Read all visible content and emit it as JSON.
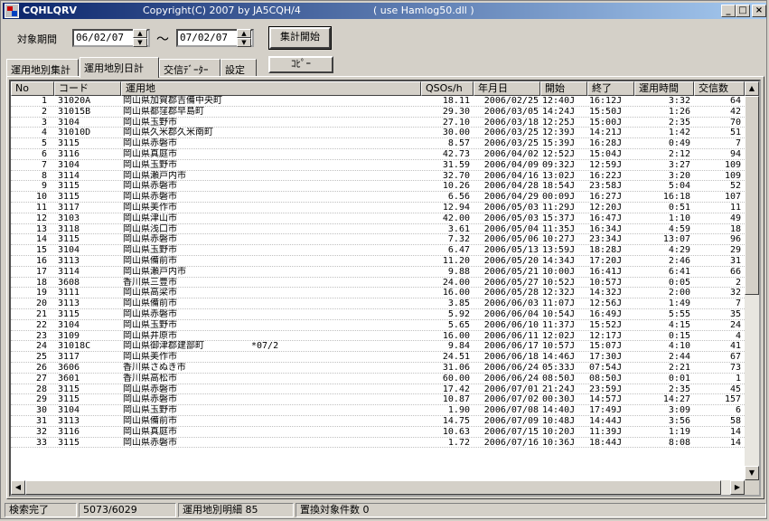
{
  "window": {
    "title": "CQHLQRV",
    "copyright": "Copyright(C) 2007  by  JA5CQH/4",
    "use_hint": "( use Hamlog50.dll )",
    "minimize": "_",
    "maximize": "□",
    "close": "×"
  },
  "toolbar": {
    "period_label": "対象期間",
    "date_from": "06/02/07",
    "tilde": "～",
    "date_to": "07/02/07",
    "aggregate_button": "集計開始",
    "copy_button": "ｺﾋﾟｰ"
  },
  "tabs": [
    {
      "label": "運用地別集計"
    },
    {
      "label": "運用地別日計"
    },
    {
      "label": "交信ﾃﾞｰﾀｰ"
    },
    {
      "label": "設定"
    }
  ],
  "active_tab": "運用地別日計",
  "columns": [
    "No",
    "コード",
    "運用地",
    "QSOs/h",
    "年月日",
    "開始",
    "終了",
    "運用時間",
    "交信数"
  ],
  "rows": [
    [
      "1",
      "31020A",
      "岡山県加賀郡吉備中央町",
      "",
      "18.11",
      "2006/02/25",
      "12:40J",
      "16:12J",
      "3:32",
      "64"
    ],
    [
      "2",
      "31015B",
      "岡山県都窪郡早島町",
      "",
      "29.30",
      "2006/03/05",
      "14:24J",
      "15:50J",
      "1:26",
      "42"
    ],
    [
      "3",
      "3104",
      "岡山県玉野市",
      "",
      "27.10",
      "2006/03/18",
      "12:25J",
      "15:00J",
      "2:35",
      "70"
    ],
    [
      "4",
      "31010D",
      "岡山県久米郡久米南町",
      "",
      "30.00",
      "2006/03/25",
      "12:39J",
      "14:21J",
      "1:42",
      "51"
    ],
    [
      "5",
      "3115",
      "岡山県赤磐市",
      "",
      "8.57",
      "2006/03/25",
      "15:39J",
      "16:28J",
      "0:49",
      "7"
    ],
    [
      "6",
      "3116",
      "岡山県真庭市",
      "",
      "42.73",
      "2006/04/02",
      "12:52J",
      "15:04J",
      "2:12",
      "94"
    ],
    [
      "7",
      "3104",
      "岡山県玉野市",
      "",
      "31.59",
      "2006/04/09",
      "09:32J",
      "12:59J",
      "3:27",
      "109"
    ],
    [
      "8",
      "3114",
      "岡山県瀬戸内市",
      "",
      "32.70",
      "2006/04/16",
      "13:02J",
      "16:22J",
      "3:20",
      "109"
    ],
    [
      "9",
      "3115",
      "岡山県赤磐市",
      "",
      "10.26",
      "2006/04/28",
      "18:54J",
      "23:58J",
      "5:04",
      "52"
    ],
    [
      "10",
      "3115",
      "岡山県赤磐市",
      "",
      "6.56",
      "2006/04/29",
      "00:09J",
      "16:27J",
      "16:18",
      "107"
    ],
    [
      "11",
      "3117",
      "岡山県美作市",
      "",
      "12.94",
      "2006/05/03",
      "11:29J",
      "12:20J",
      "0:51",
      "11"
    ],
    [
      "12",
      "3103",
      "岡山県津山市",
      "",
      "42.00",
      "2006/05/03",
      "15:37J",
      "16:47J",
      "1:10",
      "49"
    ],
    [
      "13",
      "3118",
      "岡山県浅口市",
      "",
      "3.61",
      "2006/05/04",
      "11:35J",
      "16:34J",
      "4:59",
      "18"
    ],
    [
      "14",
      "3115",
      "岡山県赤磐市",
      "",
      "7.32",
      "2006/05/06",
      "10:27J",
      "23:34J",
      "13:07",
      "96"
    ],
    [
      "15",
      "3104",
      "岡山県玉野市",
      "",
      "6.47",
      "2006/05/13",
      "13:59J",
      "18:28J",
      "4:29",
      "29"
    ],
    [
      "16",
      "3113",
      "岡山県備前市",
      "",
      "11.20",
      "2006/05/20",
      "14:34J",
      "17:20J",
      "2:46",
      "31"
    ],
    [
      "17",
      "3114",
      "岡山県瀬戸内市",
      "",
      "9.88",
      "2006/05/21",
      "10:00J",
      "16:41J",
      "6:41",
      "66"
    ],
    [
      "18",
      "3608",
      "香川県三豊市",
      "",
      "24.00",
      "2006/05/27",
      "10:52J",
      "10:57J",
      "0:05",
      "2"
    ],
    [
      "19",
      "3111",
      "岡山県高梁市",
      "",
      "16.00",
      "2006/05/28",
      "12:32J",
      "14:32J",
      "2:00",
      "32"
    ],
    [
      "20",
      "3113",
      "岡山県備前市",
      "",
      "3.85",
      "2006/06/03",
      "11:07J",
      "12:56J",
      "1:49",
      "7"
    ],
    [
      "21",
      "3115",
      "岡山県赤磐市",
      "",
      "5.92",
      "2006/06/04",
      "10:54J",
      "16:49J",
      "5:55",
      "35"
    ],
    [
      "22",
      "3104",
      "岡山県玉野市",
      "",
      "5.65",
      "2006/06/10",
      "11:37J",
      "15:52J",
      "4:15",
      "24"
    ],
    [
      "23",
      "3109",
      "岡山県井原市",
      "",
      "16.00",
      "2006/06/11",
      "12:02J",
      "12:17J",
      "0:15",
      "4"
    ],
    [
      "24",
      "31018C",
      "岡山県御津郡建部町",
      "*07/2",
      "9.84",
      "2006/06/17",
      "10:57J",
      "15:07J",
      "4:10",
      "41"
    ],
    [
      "25",
      "3117",
      "岡山県美作市",
      "",
      "24.51",
      "2006/06/18",
      "14:46J",
      "17:30J",
      "2:44",
      "67"
    ],
    [
      "26",
      "3606",
      "香川県さぬき市",
      "",
      "31.06",
      "2006/06/24",
      "05:33J",
      "07:54J",
      "2:21",
      "73"
    ],
    [
      "27",
      "3601",
      "香川県高松市",
      "",
      "60.00",
      "2006/06/24",
      "08:50J",
      "08:50J",
      "0:01",
      "1"
    ],
    [
      "28",
      "3115",
      "岡山県赤磐市",
      "",
      "17.42",
      "2006/07/01",
      "21:24J",
      "23:59J",
      "2:35",
      "45"
    ],
    [
      "29",
      "3115",
      "岡山県赤磐市",
      "",
      "10.87",
      "2006/07/02",
      "00:30J",
      "14:57J",
      "14:27",
      "157"
    ],
    [
      "30",
      "3104",
      "岡山県玉野市",
      "",
      "1.90",
      "2006/07/08",
      "14:40J",
      "17:49J",
      "3:09",
      "6"
    ],
    [
      "31",
      "3113",
      "岡山県備前市",
      "",
      "14.75",
      "2006/07/09",
      "10:48J",
      "14:44J",
      "3:56",
      "58"
    ],
    [
      "32",
      "3116",
      "岡山県真庭市",
      "",
      "10.63",
      "2006/07/15",
      "10:20J",
      "11:39J",
      "1:19",
      "14"
    ],
    [
      "33",
      "3115",
      "岡山県赤磐市",
      "",
      "1.72",
      "2006/07/16",
      "10:36J",
      "18:44J",
      "8:08",
      "14"
    ]
  ],
  "statusbar": {
    "status": "検索完了",
    "count": "5073/6029",
    "detail": "運用地別明細 85",
    "replace": "置換対象件数 0"
  },
  "icons": {
    "app": "app-icon",
    "up": "▲",
    "down": "▼",
    "left": "◀",
    "right": "▶"
  }
}
